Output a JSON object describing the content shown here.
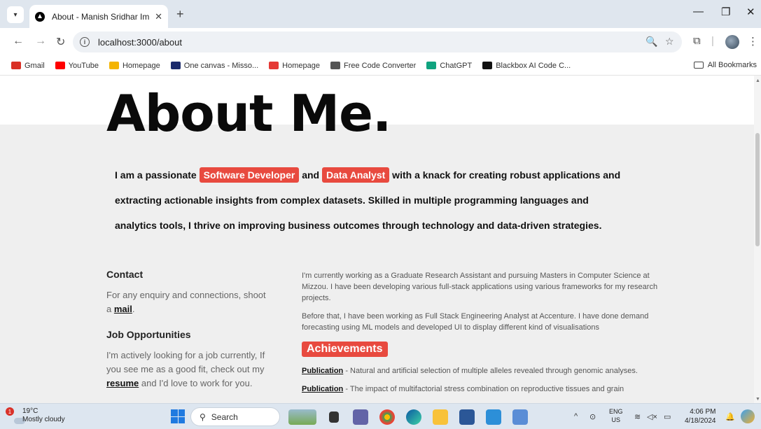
{
  "browser": {
    "tab_title": "About - Manish Sridhar Immac",
    "tab_close": "✕",
    "new_tab": "+",
    "url": "localhost:3000/about",
    "window": {
      "minimize": "—",
      "restore": "❐",
      "close": "✕"
    }
  },
  "bookmarks": [
    {
      "label": "Gmail",
      "color": "#d93025"
    },
    {
      "label": "YouTube",
      "color": "#ff0000"
    },
    {
      "label": "Homepage",
      "color": "#f4b400"
    },
    {
      "label": "One canvas - Misso...",
      "color": "#1b2a6b"
    },
    {
      "label": "Homepage",
      "color": "#e53935"
    },
    {
      "label": "Free Code Converter",
      "color": "#555555"
    },
    {
      "label": "ChatGPT",
      "color": "#10a37f"
    },
    {
      "label": "Blackbox AI Code C...",
      "color": "#111111"
    }
  ],
  "all_bookmarks": "All Bookmarks",
  "page": {
    "heading": "About Me.",
    "intro": {
      "part1": "I am a passionate ",
      "highlight1": "Software Developer",
      "part2": " and ",
      "highlight2": "Data Analyst",
      "part3": " with a knack for creating robust applications and extracting actionable insights from complex datasets. Skilled in multiple programming languages and analytics tools, I thrive on improving business outcomes through technology and data-driven strategies."
    },
    "contact": {
      "title": "Contact",
      "text": "For any enquiry and connections, shoot a ",
      "link": "mail",
      "after": "."
    },
    "jobs": {
      "title": "Job Opportunities",
      "text1": "I'm actively looking for a job currently, If you see me as a good fit, check out my ",
      "link": "resume",
      "text2": " and I'd love to work for you."
    },
    "bio": [
      "I'm currently working as a Graduate Research Assistant and pursuing Masters in Computer Science at Mizzou. I have been developing various full-stack applications using various frameworks for my research projects.",
      "Before that, I have been working as Full Stack Engineering Analyst at Accenture. I have done demand forecasting using ML models and developed UI to display different kind of visualisations"
    ],
    "achievements_title": "Achievements",
    "publications": [
      {
        "label": "Publication",
        "text": " - Natural and artificial selection of multiple alleles revealed through genomic analyses."
      },
      {
        "label": "Publication",
        "text": " - The impact of multifactorial stress combination on reproductive tissues and grain"
      }
    ]
  },
  "taskbar": {
    "weather_badge": "1",
    "temperature": "19°C",
    "condition": "Mostly cloudy",
    "search": "Search",
    "lang1": "ENG",
    "lang2": "US",
    "time": "4:06 PM",
    "date": "4/18/2024"
  }
}
